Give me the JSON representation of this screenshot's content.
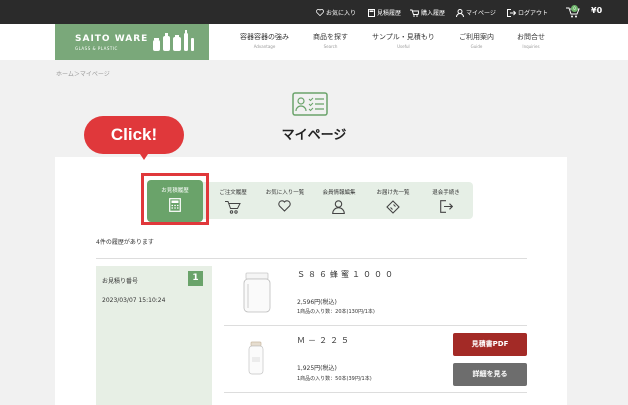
{
  "topbar": {
    "favorites": "お気に入り",
    "quote_history": "見積履歴",
    "purchase_history": "購入履歴",
    "mypage": "マイページ",
    "logout": "ログアウト",
    "cart_count": "0",
    "cart_total": "¥0"
  },
  "logo": {
    "name": "SAITO WARE",
    "sub": "GLASS & PLASTIC"
  },
  "nav": [
    {
      "jp": "容器容器の強み",
      "en": "Advantage"
    },
    {
      "jp": "商品を探す",
      "en": "Search"
    },
    {
      "jp": "サンプル・見積もり",
      "en": "Useful"
    },
    {
      "jp": "ご利用案内",
      "en": "Guide"
    },
    {
      "jp": "お問合せ",
      "en": "Inquiries"
    }
  ],
  "breadcrumb": "ホーム＞マイページ",
  "page_title": "マイページ",
  "callout": "Click!",
  "tabs": [
    {
      "label": "お見積履歴",
      "icon": "calculator-icon"
    },
    {
      "label": "ご注文履歴",
      "icon": "cart-icon"
    },
    {
      "label": "お気に入り一覧",
      "icon": "heart-icon"
    },
    {
      "label": "会員情報編集",
      "icon": "user-icon"
    },
    {
      "label": "お届け先一覧",
      "icon": "ticket-icon"
    },
    {
      "label": "退会手続き",
      "icon": "exit-icon"
    }
  ],
  "history_count": "4件の履歴があります",
  "quote": {
    "label": "お見積り番号",
    "number": "1",
    "date": "2023/03/07 15:10:24"
  },
  "items": [
    {
      "name": "Ｓ８６蜂蜜１０００",
      "price": "2,596円(税込)",
      "qty": "1商品の入り数：20本(130円/1本)"
    },
    {
      "name": "Ｍ－２２５",
      "price": "1,925円(税込)",
      "qty": "1商品の入り数：50本(39円/1本)"
    }
  ],
  "buttons": {
    "pdf": "見積書PDF",
    "detail": "詳細を見る"
  },
  "colors": {
    "accent_green": "#6aa36a",
    "callout_red": "#e0383b",
    "pdf_button": "#a32a26"
  }
}
